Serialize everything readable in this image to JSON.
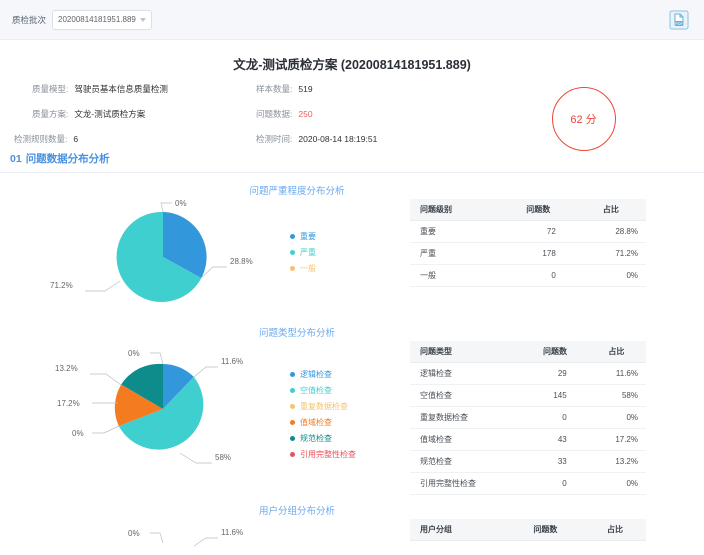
{
  "topbar": {
    "filter_label": "质检批次",
    "selected_batch": "20200814181951.889",
    "export_icon": "pdf-export-icon"
  },
  "header": {
    "title": "文龙-测试质检方案 (20200814181951.889)",
    "meta_left": [
      {
        "key": "质量模型",
        "value": "驾驶员基本信息质量检测"
      },
      {
        "key": "质量方案",
        "value": "文龙-测试质检方案"
      },
      {
        "key": "检测规则数量",
        "value": "6"
      }
    ],
    "meta_right": [
      {
        "key": "样本数量",
        "value": "519",
        "highlight": false
      },
      {
        "key": "问题数据",
        "value": "250",
        "highlight": true
      },
      {
        "key": "检测时间",
        "value": "2020-08-14 18:19:51",
        "highlight": false
      }
    ],
    "score": "62 分",
    "score_color": "#f0453a"
  },
  "section": {
    "number": "01",
    "title": "问题数据分布分析"
  },
  "colors": {
    "blue": "#3398db",
    "teal": "#40cfcf",
    "orange": "#f47b20",
    "dark_teal": "#0e8c8c",
    "light_orange": "#f5c36e",
    "red": "#e8515b"
  },
  "chart_data": [
    {
      "type": "pie",
      "title": "问题严重程度分布分析",
      "categories": [
        "重要",
        "严重",
        "一般"
      ],
      "values": [
        72,
        178,
        0
      ],
      "percents": [
        "28.8%",
        "71.2%",
        "0%"
      ],
      "colors": [
        "#3398db",
        "#40cfcf",
        "#f5c36e"
      ],
      "legend_position": "right",
      "table": {
        "columns": [
          "问题级别",
          "问题数",
          "占比"
        ],
        "rows": [
          [
            "重要",
            "72",
            "28.8%"
          ],
          [
            "严重",
            "178",
            "71.2%"
          ],
          [
            "一般",
            "0",
            "0%"
          ]
        ]
      }
    },
    {
      "type": "pie",
      "title": "问题类型分布分析",
      "categories": [
        "逻辑检查",
        "空值检查",
        "重复数据检查",
        "值域检查",
        "规范检查",
        "引用完整性检查"
      ],
      "values": [
        29,
        145,
        0,
        43,
        33,
        0
      ],
      "percents": [
        "11.6%",
        "58%",
        "0%",
        "17.2%",
        "13.2%",
        "0%"
      ],
      "colors": [
        "#3398db",
        "#40cfcf",
        "#f5c36e",
        "#f47b20",
        "#0e8c8c",
        "#e8515b"
      ],
      "legend_position": "right",
      "table": {
        "columns": [
          "问题类型",
          "问题数",
          "占比"
        ],
        "rows": [
          [
            "逻辑检查",
            "29",
            "11.6%"
          ],
          [
            "空值检查",
            "145",
            "58%"
          ],
          [
            "重复数据检查",
            "0",
            "0%"
          ],
          [
            "值域检查",
            "43",
            "17.2%"
          ],
          [
            "规范检查",
            "33",
            "13.2%"
          ],
          [
            "引用完整性检查",
            "0",
            "0%"
          ]
        ]
      }
    },
    {
      "type": "pie",
      "title": "用户分组分布分析",
      "categories": [],
      "values": [],
      "percents": [
        "0%",
        "11.6%"
      ],
      "colors": [
        "#3398db",
        "#40cfcf"
      ],
      "legend_position": "right",
      "table": {
        "columns": [
          "用户分组",
          "问题数",
          "占比"
        ],
        "rows": []
      }
    }
  ]
}
